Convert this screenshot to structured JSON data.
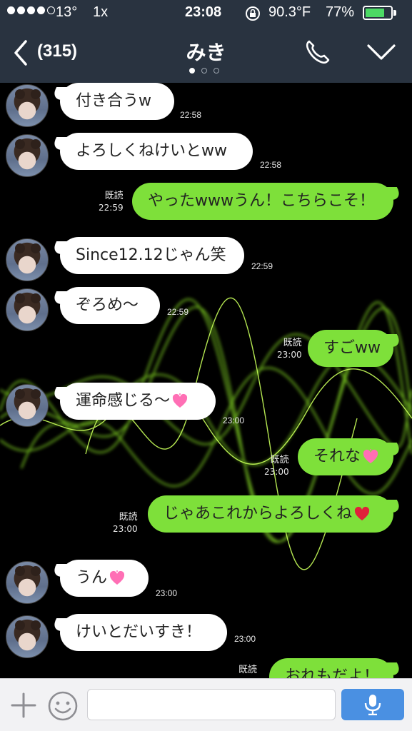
{
  "status_bar": {
    "carrier_temp": "13°",
    "mode": "1x",
    "time": "23:08",
    "temperature": "90.3°F",
    "battery_percent": "77%",
    "battery_level": 0.77,
    "signal_bars_filled": 4,
    "signal_bars_total": 5
  },
  "header": {
    "back_count": "(315)",
    "title": "みき",
    "page_indicator": {
      "count": 3,
      "active": 0
    }
  },
  "messages": [
    {
      "side": "in",
      "text": "付き合うw",
      "time": "22:58"
    },
    {
      "side": "in",
      "text": "よろしくねけいとww",
      "time": "22:58"
    },
    {
      "side": "out",
      "text": "やったwwwうん！こちらこそ！",
      "read": "既読",
      "time": "22:59"
    },
    {
      "side": "in",
      "text": "Since12.12じゃん笑",
      "time": "22:59"
    },
    {
      "side": "in",
      "text": "ぞろめ〜",
      "time": "22:59"
    },
    {
      "side": "out",
      "text": "すごww",
      "read": "既読",
      "time": "23:00"
    },
    {
      "side": "in",
      "text": "運命感じる〜",
      "emoji": "sparkling-heart",
      "time": "23:00"
    },
    {
      "side": "out",
      "text": "それな",
      "emoji": "sparkling-heart",
      "read": "既読",
      "time": "23:00"
    },
    {
      "side": "out",
      "text": "じゃあこれからよろしくね",
      "emoji": "red-heart",
      "read": "既読",
      "time": "23:00"
    },
    {
      "side": "in",
      "text": "うん",
      "emoji": "sparkling-heart",
      "time": "23:00"
    },
    {
      "side": "in",
      "text": "けいとだいすき！",
      "time": "23:00"
    },
    {
      "side": "out",
      "text": "おれもだよ！",
      "read": "既読",
      "time": ""
    }
  ],
  "input_bar": {
    "placeholder": "",
    "icons": [
      "plus-icon",
      "smiley-icon",
      "mic-icon"
    ]
  },
  "colors": {
    "header_bg": "#293340",
    "incoming_bubble": "#ffffff",
    "outgoing_bubble": "#7ee03a",
    "mic_button": "#4a90e2",
    "background_wave": "#9cff2a"
  }
}
